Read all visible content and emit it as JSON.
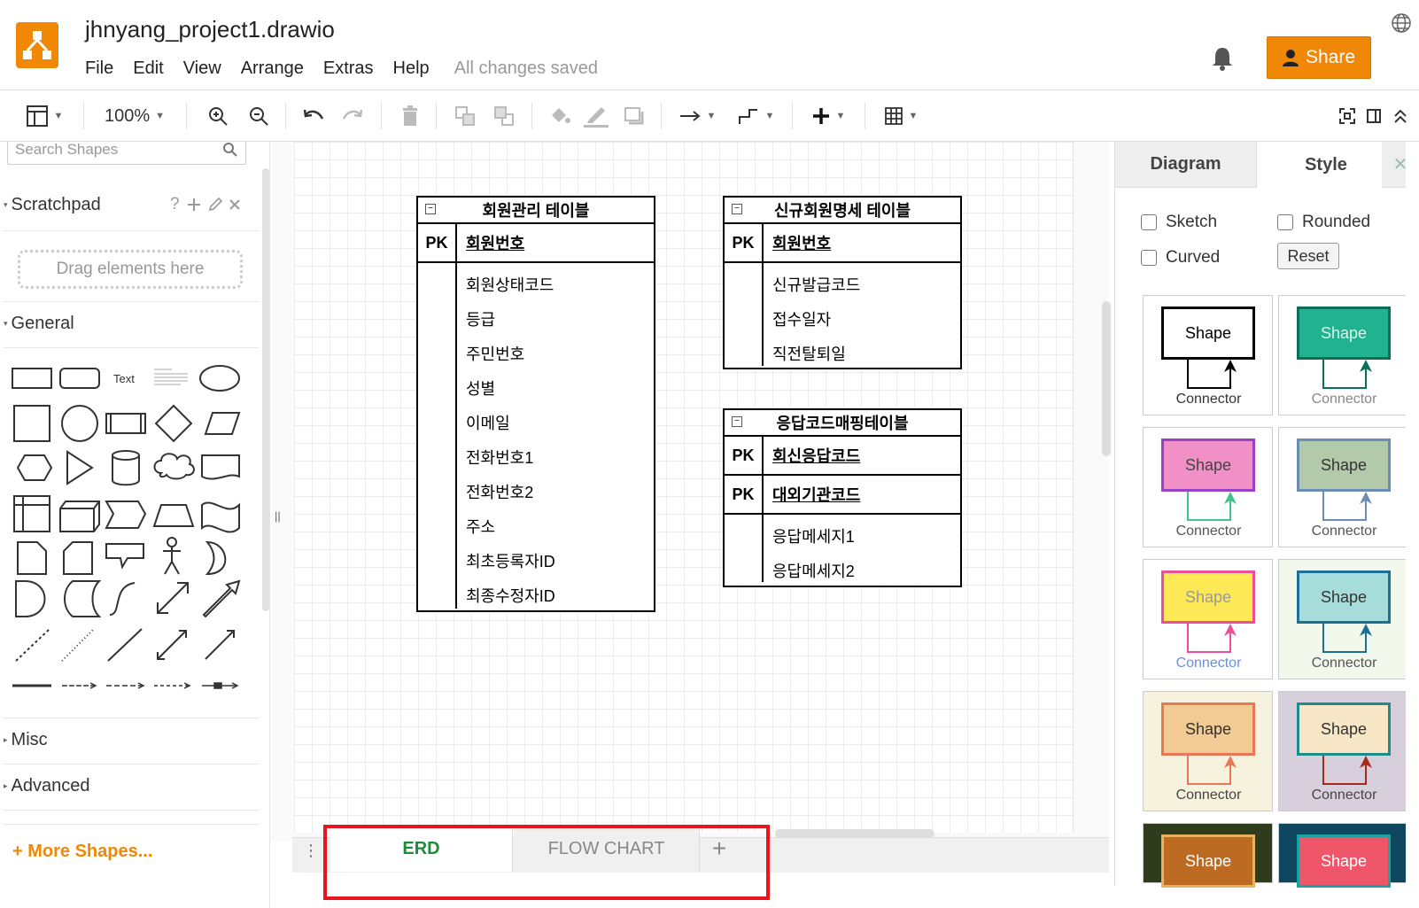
{
  "header": {
    "title": "jhnyang_project1.drawio",
    "menus": [
      "File",
      "Edit",
      "View",
      "Arrange",
      "Extras",
      "Help"
    ],
    "save_status": "All changes saved",
    "share_label": "Share"
  },
  "toolbar": {
    "zoom": "100%",
    "icons": [
      "format-panel-icon",
      "zoom-in-icon",
      "zoom-out-icon",
      "undo-icon",
      "redo-icon",
      "delete-icon",
      "to-front-icon",
      "to-back-icon",
      "fill-color-icon",
      "line-color-icon",
      "shadow-icon",
      "connection-icon",
      "waypoints-icon",
      "insert-icon",
      "table-icon",
      "fullscreen-icon",
      "format-toggle-icon",
      "collapse-icon"
    ]
  },
  "sidebar": {
    "search_placeholder": "Search Shapes",
    "scratchpad": {
      "label": "Scratchpad",
      "help": "?",
      "drop_hint": "Drag elements here"
    },
    "general_label": "General",
    "text_shape_label": "Text",
    "misc_label": "Misc",
    "advanced_label": "Advanced",
    "more_shapes": "More Shapes..."
  },
  "erd_tables": [
    {
      "title": "회원관리 테이블",
      "pk_rows": [
        {
          "pk": "PK",
          "name": "회원번호"
        }
      ],
      "fields": [
        "회원상태코드",
        "등급",
        "주민번호",
        "성별",
        "이메일",
        "전화번호1",
        "전화번호2",
        "주소",
        "최초등록자ID",
        "최종수정자ID"
      ]
    },
    {
      "title": "신규회원명세 테이블",
      "pk_rows": [
        {
          "pk": "PK",
          "name": "회원번호"
        }
      ],
      "fields": [
        "신규발급코드",
        "접수일자",
        "직전탈퇴일"
      ]
    },
    {
      "title": "응답코드매핑테이블",
      "pk_rows": [
        {
          "pk": "PK",
          "name": "회신응답코드"
        },
        {
          "pk": "PK",
          "name": "대외기관코드"
        }
      ],
      "fields": [
        "응답메세지1",
        "응답메세지2"
      ]
    }
  ],
  "pages": {
    "tabs": [
      "ERD",
      "FLOW CHART"
    ],
    "active": "ERD",
    "add_label": "+"
  },
  "format_panel": {
    "tabs": [
      "Diagram",
      "Style"
    ],
    "close": "✕",
    "options": {
      "sketch": "Sketch",
      "rounded": "Rounded",
      "curved": "Curved",
      "reset": "Reset"
    },
    "style_cards": [
      {
        "shape": "Shape",
        "connector": "Connector",
        "fill": "#ffffff",
        "stroke": "#000000",
        "text": "#000000",
        "bg": "#ffffff",
        "line": "#000000",
        "ctext": "#333333"
      },
      {
        "shape": "Shape",
        "connector": "Connector",
        "fill": "#21b28f",
        "stroke": "#0b6e58",
        "text": "#d8f3ec",
        "bg": "#ffffff",
        "line": "#0b6e58",
        "ctext": "#888888"
      },
      {
        "shape": "Shape",
        "connector": "Connector",
        "fill": "#f190c7",
        "stroke": "#9a41c9",
        "text": "#444444",
        "bg": "#ffffff",
        "line": "#3fc58a",
        "ctext": "#555555"
      },
      {
        "shape": "Shape",
        "connector": "Connector",
        "fill": "#b2c9aa",
        "stroke": "#6b8cb4",
        "text": "#333333",
        "bg": "#ffffff",
        "line": "#6b8cb4",
        "ctext": "#555555"
      },
      {
        "shape": "Shape",
        "connector": "Connector",
        "fill": "#fde956",
        "stroke": "#ee4d9b",
        "text": "#999999",
        "bg": "#ffffff",
        "line": "#ee4d9b",
        "ctext": "#6b8fd6"
      },
      {
        "shape": "Shape",
        "connector": "Connector",
        "fill": "#a6dcd9",
        "stroke": "#1e6f96",
        "text": "#333333",
        "bg": "#f2f8ec",
        "line": "#1e6f96",
        "ctext": "#555555"
      },
      {
        "shape": "Shape",
        "connector": "Connector",
        "fill": "#f2ca93",
        "stroke": "#e8775a",
        "text": "#333333",
        "bg": "#f7f2de",
        "line": "#e8775a",
        "ctext": "#444444"
      },
      {
        "shape": "Shape",
        "connector": "Connector",
        "fill": "#f7e7c7",
        "stroke": "#1b8d8a",
        "text": "#333333",
        "bg": "#d7d0dc",
        "line": "#a52a1e",
        "ctext": "#444444"
      },
      {
        "shape": "Shape",
        "connector": "",
        "fill": "#bd6b22",
        "stroke": "#e7b45d",
        "text": "#ffffff",
        "bg": "#2f3b1d",
        "line": "#e7b45d",
        "ctext": "#ffffff"
      },
      {
        "shape": "Shape",
        "connector": "",
        "fill": "#f0566a",
        "stroke": "#1aa1a1",
        "text": "#ffffff",
        "bg": "#0f475e",
        "line": "#1aa1a1",
        "ctext": "#ffffff"
      }
    ]
  },
  "colors": {
    "accent": "#f08705",
    "active_tab": "#1e8b3a",
    "highlight": "#e8161c"
  }
}
